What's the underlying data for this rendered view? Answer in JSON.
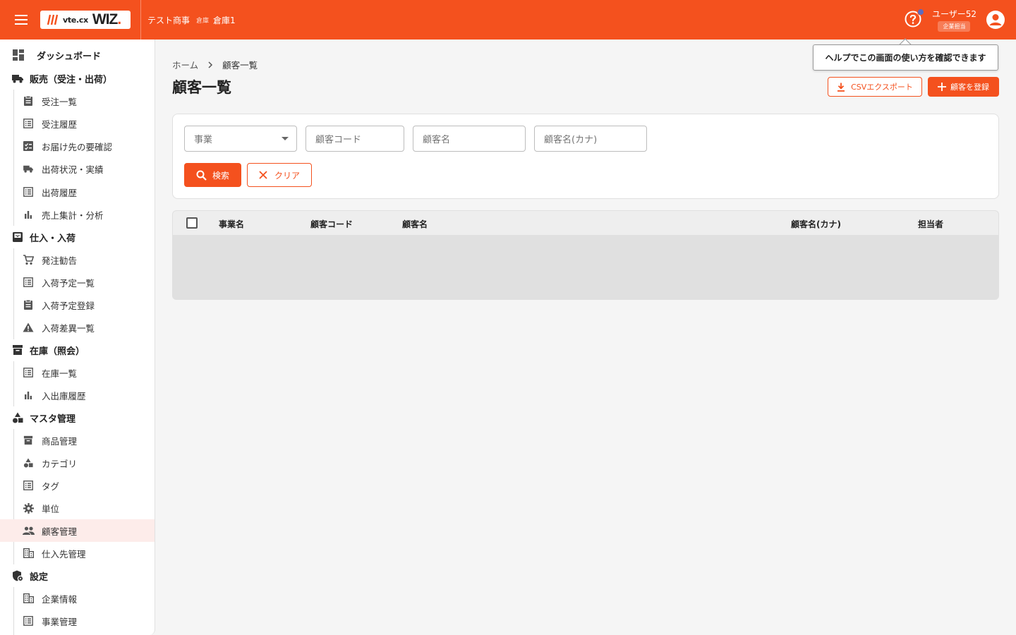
{
  "header": {
    "logo_vte": "vte.cx",
    "logo_wiz": "WIZ",
    "logo_dot": ".",
    "company": "テスト商事",
    "warehouse_label": "倉庫",
    "warehouse_name": "倉庫1",
    "user_name": "ユーザー52",
    "user_role": "企業担当",
    "accent_color": "#f4511e"
  },
  "sidebar": {
    "dashboard": "ダッシュボード",
    "sections": [
      {
        "label": "販売（受注・出荷）",
        "icon": "truck-icon",
        "items": [
          {
            "label": "受注一覧",
            "icon": "clipboard-icon"
          },
          {
            "label": "受注履歴",
            "icon": "list-icon"
          },
          {
            "label": "お届け先の要確認",
            "icon": "checklist-icon"
          },
          {
            "label": "出荷状況・実績",
            "icon": "truck-icon"
          },
          {
            "label": "出荷履歴",
            "icon": "list-icon"
          },
          {
            "label": "売上集計・分析",
            "icon": "bar-chart-icon"
          }
        ]
      },
      {
        "label": "仕入・入荷",
        "icon": "inbox-icon",
        "items": [
          {
            "label": "発注勧告",
            "icon": "cart-icon"
          },
          {
            "label": "入荷予定一覧",
            "icon": "list-icon"
          },
          {
            "label": "入荷予定登録",
            "icon": "clipboard-icon"
          },
          {
            "label": "入荷差異一覧",
            "icon": "warning-icon"
          }
        ]
      },
      {
        "label": "在庫（照会）",
        "icon": "archive-icon",
        "items": [
          {
            "label": "在庫一覧",
            "icon": "list-icon"
          },
          {
            "label": "入出庫履歴",
            "icon": "bar-chart-icon"
          }
        ]
      },
      {
        "label": "マスタ管理",
        "icon": "shapes-icon",
        "items": [
          {
            "label": "商品管理",
            "icon": "archive-icon"
          },
          {
            "label": "カテゴリ",
            "icon": "shapes-icon"
          },
          {
            "label": "タグ",
            "icon": "list-icon"
          },
          {
            "label": "単位",
            "icon": "gear-icon"
          },
          {
            "label": "顧客管理",
            "icon": "people-icon",
            "active": true
          },
          {
            "label": "仕入先管理",
            "icon": "building-icon"
          }
        ]
      },
      {
        "label": "設定",
        "icon": "admin-icon",
        "items": [
          {
            "label": "企業情報",
            "icon": "building-icon"
          },
          {
            "label": "事業管理",
            "icon": "list-icon"
          }
        ]
      }
    ]
  },
  "main": {
    "breadcrumb": {
      "home": "ホーム",
      "current": "顧客一覧"
    },
    "title": "顧客一覧",
    "tooltip": "ヘルプでこの画面の使い方を確認できます",
    "csv_button": "CSVエクスポート",
    "register_button": "顧客を登録",
    "filters": {
      "business_placeholder": "事業",
      "code_placeholder": "顧客コード",
      "name_placeholder": "顧客名",
      "kana_placeholder": "顧客名(カナ)"
    },
    "search_button": "検索",
    "clear_button": "クリア",
    "table": {
      "columns": [
        "事業名",
        "顧客コード",
        "顧客名",
        "顧客名(カナ)",
        "担当者"
      ]
    }
  }
}
